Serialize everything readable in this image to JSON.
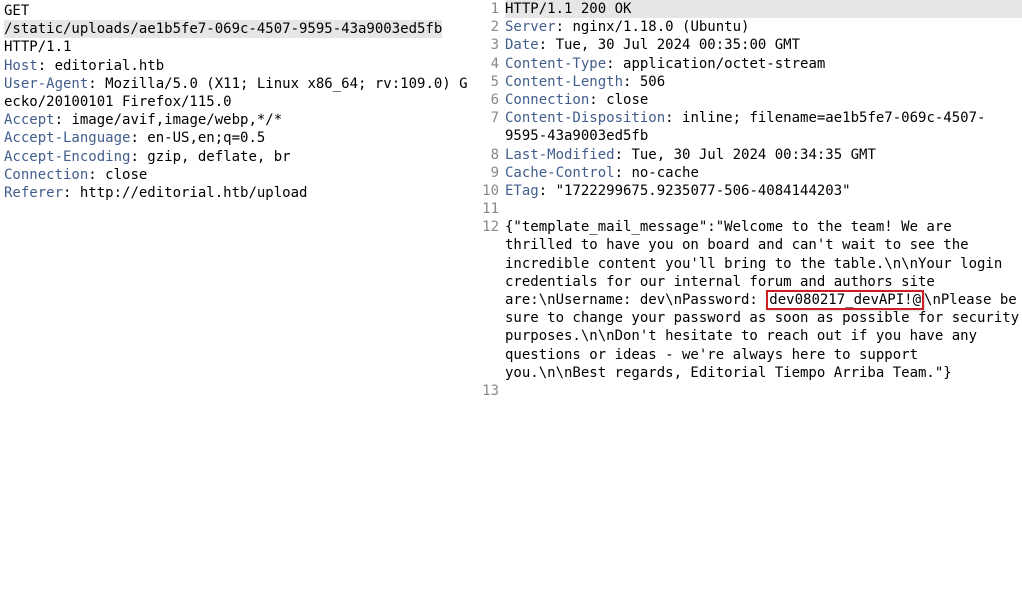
{
  "request": {
    "method": "GET",
    "path": "/static/uploads/ae1b5fe7-069c-4507-9595-43a9003ed5fb",
    "protocol": "HTTP/1.1",
    "headers": [
      {
        "name": "Host",
        "value": "editorial.htb"
      },
      {
        "name": "User-Agent",
        "value": "Mozilla/5.0 (X11; Linux x86_64; rv:109.0) Gecko/20100101 Firefox/115.0"
      },
      {
        "name": "Accept",
        "value": "image/avif,image/webp,*/*"
      },
      {
        "name": "Accept-Language",
        "value": "en-US,en;q=0.5"
      },
      {
        "name": "Accept-Encoding",
        "value": "gzip, deflate, br"
      },
      {
        "name": "Connection",
        "value": "close"
      },
      {
        "name": "Referer",
        "value": "http://editorial.htb/upload"
      }
    ]
  },
  "response": {
    "status_line": "HTTP/1.1 200 OK",
    "headers": [
      {
        "n": 2,
        "name": "Server",
        "value": "nginx/1.18.0 (Ubuntu)"
      },
      {
        "n": 3,
        "name": "Date",
        "value": "Tue, 30 Jul 2024 00:35:00 GMT"
      },
      {
        "n": 4,
        "name": "Content-Type",
        "value": "application/octet-stream"
      },
      {
        "n": 5,
        "name": "Content-Length",
        "value": "506"
      },
      {
        "n": 6,
        "name": "Connection",
        "value": "close"
      },
      {
        "n": 7,
        "name": "Content-Disposition",
        "value": "inline; filename=ae1b5fe7-069c-4507-9595-43a9003ed5fb"
      },
      {
        "n": 8,
        "name": "Last-Modified",
        "value": "Tue, 30 Jul 2024 00:34:35 GMT"
      },
      {
        "n": 9,
        "name": "Cache-Control",
        "value": "no-cache"
      },
      {
        "n": 10,
        "name": "ETag",
        "value": "\"1722299675.9235077-506-4084144203\""
      }
    ],
    "body_pre": "{\"template_mail_message\":\"Welcome to the team! We are thrilled to have you on board and can't wait to see the incredible content you'll bring to the table.\\n\\nYour login credentials for our internal forum and authors site are:\\nUsername: dev\\nPassword: ",
    "credential": "dev080217_devAPI!@",
    "body_post": "\\nPlease be sure to change your password as soon as possible for security purposes.\\n\\nDon't hesitate to reach out if you have any questions or ideas - we're always here to support you.\\n\\nBest regards, Editorial Tiempo Arriba Team.\"}",
    "line_numbers": {
      "status": 1,
      "blank": 11,
      "body": 12,
      "trailing": 13
    }
  }
}
